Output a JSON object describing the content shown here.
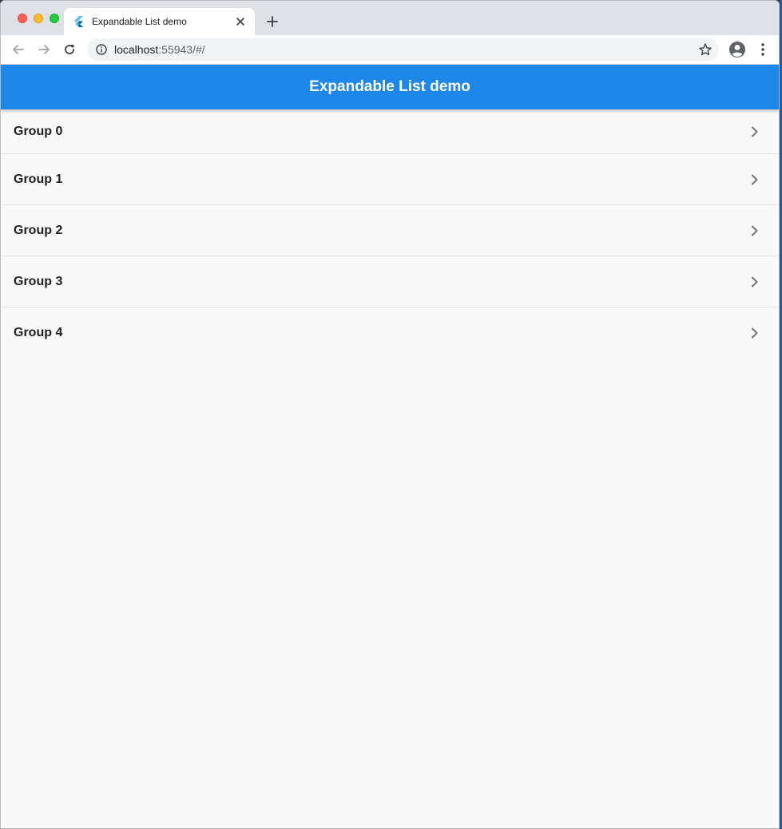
{
  "browser": {
    "tab_title": "Expandable List demo",
    "url_host": "localhost",
    "url_path": ":55943/#/"
  },
  "app": {
    "title": "Expandable List demo",
    "accent_color": "#1e88ea"
  },
  "groups": [
    {
      "label": "Group 0"
    },
    {
      "label": "Group 1"
    },
    {
      "label": "Group 2"
    },
    {
      "label": "Group 3"
    },
    {
      "label": "Group 4"
    }
  ]
}
